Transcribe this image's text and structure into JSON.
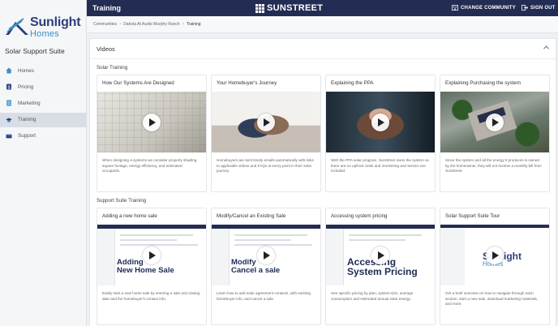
{
  "sidebar": {
    "brand_name": "Sunlight",
    "brand_sub": "Homes",
    "suite_title": "Solar Support Suite",
    "items": [
      {
        "label": "Homes",
        "icon": "house-icon"
      },
      {
        "label": "Pricing",
        "icon": "dollar-icon"
      },
      {
        "label": "Marketing",
        "icon": "document-icon"
      },
      {
        "label": "Training",
        "icon": "graduation-cap-icon",
        "active": true
      },
      {
        "label": "Support",
        "icon": "support-icon"
      }
    ]
  },
  "header": {
    "title": "Training",
    "brand": "SUNSTREET",
    "change_community": "CHANGE COMMUNITY",
    "sign_out": "SIGN OUT"
  },
  "breadcrumb": {
    "items": [
      "Communities",
      "Dakota At Audie Murphy Ranch",
      "Training"
    ]
  },
  "videos": {
    "title": "Videos",
    "sections": [
      {
        "label": "Solar Training",
        "cards": [
          {
            "title": "How Our Systems Are Designed",
            "desc": "When designing a systems we consider property shading, square footage, energy efficiency, and estimated occupants."
          },
          {
            "title": "Your Homebuyer's Journey",
            "desc": "Homebuyers are sent timely emails automatically with links to applicable videos and FAQs at every point in their solar journey."
          },
          {
            "title": "Explaining the PPA",
            "desc": "With the PPA solar program, SunStreet owns the system so there are no upfront costs and monitoring and service are included."
          },
          {
            "title": "Explaining Purchasing the system",
            "desc": "Since the system and all the energy it produces is owned by the homeowner, they will not receive a monthly bill from SunStreet."
          }
        ]
      },
      {
        "label": "Support Suite Training",
        "cards": [
          {
            "title": "Adding a new home sale",
            "overlay_1": "Adding",
            "overlay_2": "New Home Sale",
            "desc": "Easily start a new home sale by entering a sale and closing date and the homebuyer's contact info."
          },
          {
            "title": "Modify/Cancel an Existing Sale",
            "overlay_1": "Modify",
            "overlay_2": "Cancel a sale",
            "desc": "Learn how to add solar agreement contacts, with existing homebuyer info, and cancel a sale."
          },
          {
            "title": "Accessing system pricing",
            "overlay_1": "Accessing",
            "overlay_2": "System Pricing",
            "desc": "See specific pricing by plan, system size, average consumption and estimated annual solar energy."
          },
          {
            "title": "Solar Support Suite Tour",
            "desc": "Get a brief overview on how to navigate through each section, start a new sale, download marketing materials, and more."
          }
        ]
      }
    ]
  }
}
